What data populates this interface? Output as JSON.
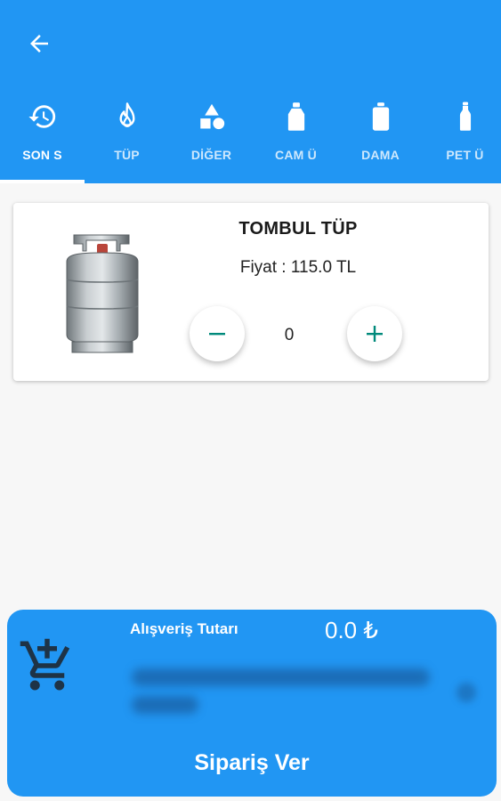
{
  "appbar": {
    "back_icon": "arrow-back-icon"
  },
  "tabs": [
    {
      "label": "SON S",
      "icon": "history-icon",
      "active": true
    },
    {
      "label": "TÜP",
      "icon": "flame-icon"
    },
    {
      "label": "DİĞER",
      "icon": "shapes-icon"
    },
    {
      "label": "CAM Ü",
      "icon": "bottle-icon"
    },
    {
      "label": "DAMA",
      "icon": "water-jug-icon"
    },
    {
      "label": "PET Ü",
      "icon": "pet-bottle-icon"
    }
  ],
  "product": {
    "name": "TOMBUL TÜP",
    "price_text": "Fiyat : 115.0 TL",
    "quantity": "0"
  },
  "cart": {
    "total_label": "Alışveriş Tutarı",
    "total_value": "0.0 ₺",
    "order_button": "Sipariş Ver"
  },
  "colors": {
    "primary": "#2196f3",
    "accent": "#00897b"
  }
}
